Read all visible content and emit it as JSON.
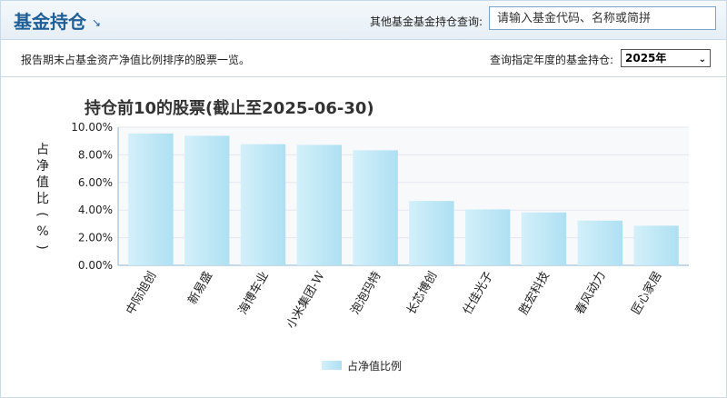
{
  "header": {
    "title": "基金持仓",
    "title_arrow": "↘",
    "search_label": "其他基金基金持仓查询:",
    "search_placeholder": "请输入基金代码、名称或简拼"
  },
  "subheader": {
    "description": "报告期末占基金资产净值比例排序的股票一览。",
    "year_label": "查询指定年度的基金持仓:",
    "year_selected": "2025年"
  },
  "chart_data": {
    "type": "bar",
    "title": "持仓前10的股票(截止至2025-06-30)",
    "ylabel": "占净值比(%)",
    "xlabel": "",
    "categories": [
      "中际旭创",
      "新易盛",
      "海博车业",
      "小米集团-W",
      "泡泡玛特",
      "长芯博创",
      "仕佳光子",
      "胜宏科技",
      "春风动力",
      "匠心家居"
    ],
    "series": [
      {
        "name": "占净值比例",
        "values": [
          9.55,
          9.38,
          8.77,
          8.72,
          8.33,
          4.66,
          4.05,
          3.83,
          3.24,
          2.87
        ]
      }
    ],
    "ylim": [
      0,
      10
    ],
    "yticks": [
      "0.00%",
      "2.00%",
      "4.00%",
      "6.00%",
      "8.00%",
      "10.00%"
    ],
    "grid": true,
    "legend_position": "bottom-center",
    "bar_color": "#bfe8f5"
  }
}
